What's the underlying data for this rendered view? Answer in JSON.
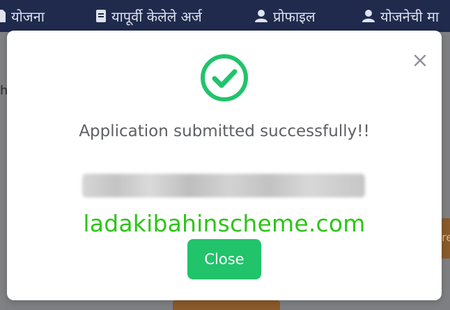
{
  "navbar": {
    "items": [
      {
        "label": "योजना",
        "icon": "document-icon"
      },
      {
        "label": "यापूर्वी केलेले अर्ज",
        "icon": "file-icon"
      },
      {
        "label": "प्रोफाइल",
        "icon": "user-icon"
      },
      {
        "label": "योजनेची मा",
        "icon": "user-icon"
      }
    ]
  },
  "background": {
    "partial_letter": "h",
    "partial_button_text": "re"
  },
  "modal": {
    "message": "Application submitted successfully!!",
    "watermark": "ladakibahinscheme.com",
    "close_button_label": "Close",
    "success_color": "#21c36b"
  }
}
